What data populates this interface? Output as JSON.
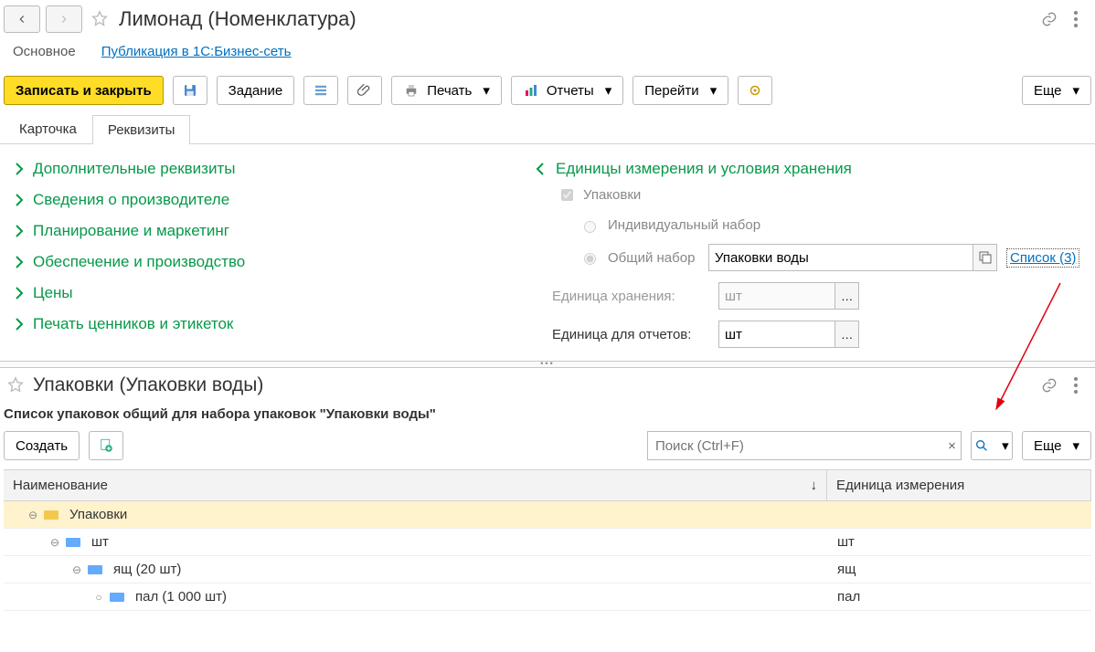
{
  "header": {
    "title": "Лимонад (Номенклатура)"
  },
  "nav": {
    "main": "Основное",
    "publish": "Публикация в 1С:Бизнес-сеть"
  },
  "toolbar": {
    "save_close": "Записать и закрыть",
    "task": "Задание",
    "print": "Печать",
    "reports": "Отчеты",
    "goto": "Перейти",
    "more": "Еще"
  },
  "tabs": {
    "card": "Карточка",
    "props": "Реквизиты"
  },
  "left_sections": [
    "Дополнительные реквизиты",
    "Сведения о производителе",
    "Планирование и маркетинг",
    "Обеспечение и производство",
    "Цены",
    "Печать ценников и этикеток"
  ],
  "right": {
    "group_title": "Единицы измерения и условия хранения",
    "pack_chk": "Упаковки",
    "radio_indiv": "Индивидуальный набор",
    "radio_common": "Общий набор",
    "common_value": "Упаковки воды",
    "list_link": "Список (3)",
    "storage_unit_label": "Единица хранения:",
    "storage_unit_value": "шт",
    "report_unit_label": "Единица для отчетов:",
    "report_unit_value": "шт"
  },
  "lower": {
    "title": "Упаковки (Упаковки воды)",
    "desc": "Список упаковок общий для набора упаковок \"Упаковки воды\"",
    "create": "Создать",
    "search_placeholder": "Поиск (Ctrl+F)",
    "more": "Еще",
    "col_name": "Наименование",
    "col_unit": "Единица измерения",
    "rows": [
      {
        "indent": 0,
        "expand": "⊖",
        "icon": "y",
        "name": "Упаковки",
        "unit": "",
        "hl": true
      },
      {
        "indent": 1,
        "expand": "⊖",
        "icon": "b",
        "name": "шт",
        "unit": "шт",
        "hl": false
      },
      {
        "indent": 2,
        "expand": "⊖",
        "icon": "b",
        "name": "ящ (20 шт)",
        "unit": "ящ",
        "hl": false
      },
      {
        "indent": 3,
        "expand": "○",
        "icon": "b",
        "name": "пал (1 000 шт)",
        "unit": "пал",
        "hl": false
      }
    ]
  }
}
